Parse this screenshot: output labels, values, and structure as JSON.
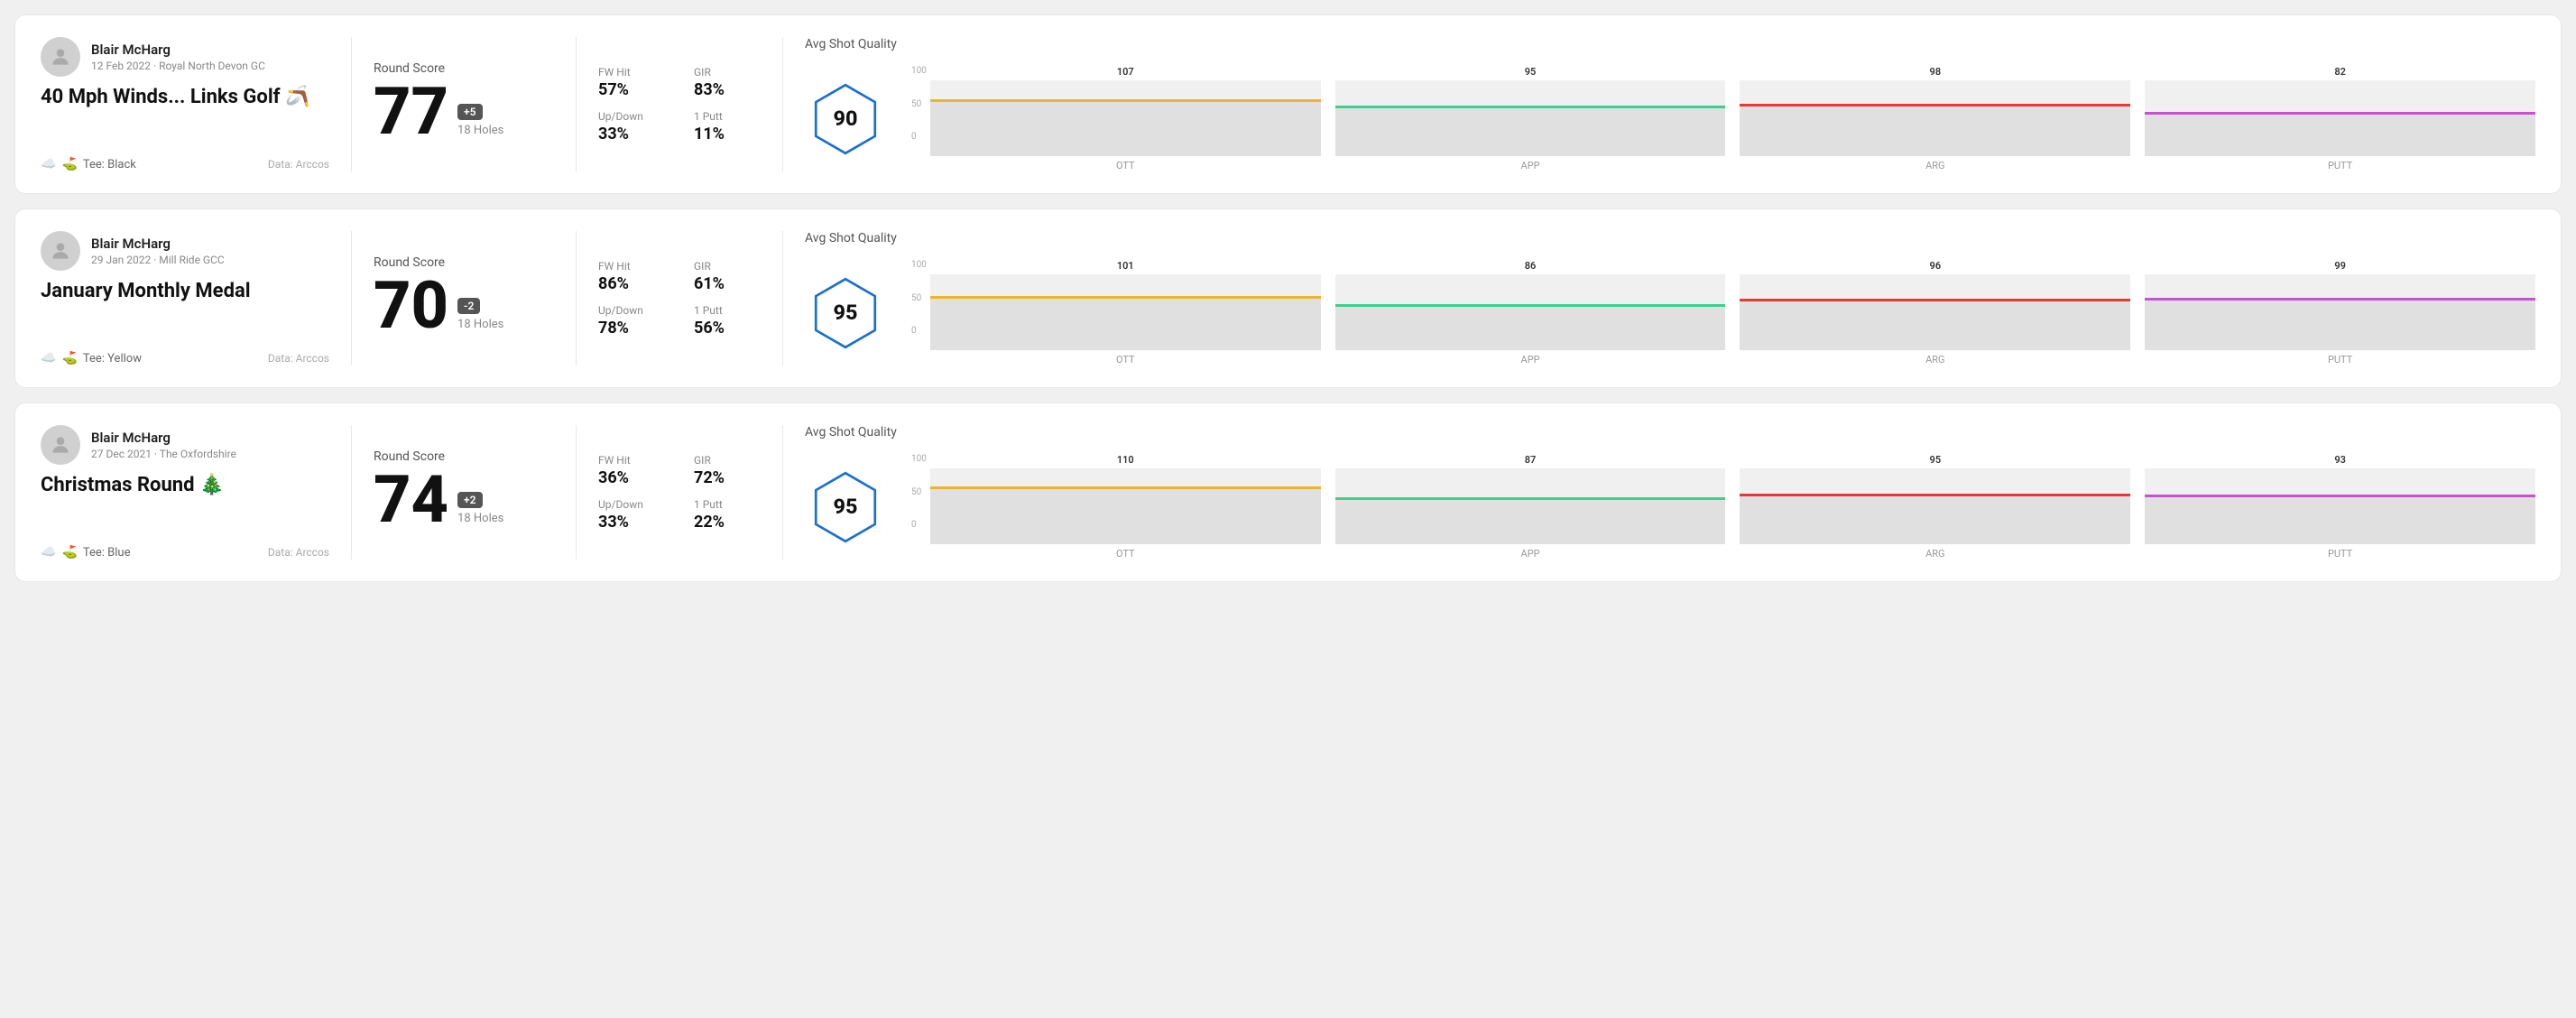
{
  "rounds": [
    {
      "id": "round1",
      "user": {
        "name": "Blair McHarg",
        "date": "12 Feb 2022 · Royal North Devon GC",
        "tee": "Black",
        "data_source": "Data: Arccos"
      },
      "title": "40 Mph Winds... Links Golf 🪃",
      "score": {
        "label": "Round Score",
        "number": "77",
        "badge": "+5",
        "badge_type": "positive",
        "holes": "18 Holes"
      },
      "stats": {
        "fw_hit_label": "FW Hit",
        "fw_hit_value": "57%",
        "gir_label": "GIR",
        "gir_value": "83%",
        "updown_label": "Up/Down",
        "updown_value": "33%",
        "oneputt_label": "1 Putt",
        "oneputt_value": "11%"
      },
      "quality": {
        "title": "Avg Shot Quality",
        "score": "90",
        "bars": [
          {
            "label": "OTT",
            "value": 107,
            "color": "#f0b429",
            "pct": 72
          },
          {
            "label": "APP",
            "value": 95,
            "color": "#3ecf8e",
            "pct": 63
          },
          {
            "label": "ARG",
            "value": 98,
            "color": "#e53935",
            "pct": 65
          },
          {
            "label": "PUTT",
            "value": 82,
            "color": "#c94fd4",
            "pct": 55
          }
        ]
      }
    },
    {
      "id": "round2",
      "user": {
        "name": "Blair McHarg",
        "date": "29 Jan 2022 · Mill Ride GCC",
        "tee": "Yellow",
        "data_source": "Data: Arccos"
      },
      "title": "January Monthly Medal",
      "score": {
        "label": "Round Score",
        "number": "70",
        "badge": "-2",
        "badge_type": "negative",
        "holes": "18 Holes"
      },
      "stats": {
        "fw_hit_label": "FW Hit",
        "fw_hit_value": "86%",
        "gir_label": "GIR",
        "gir_value": "61%",
        "updown_label": "Up/Down",
        "updown_value": "78%",
        "oneputt_label": "1 Putt",
        "oneputt_value": "56%"
      },
      "quality": {
        "title": "Avg Shot Quality",
        "score": "95",
        "bars": [
          {
            "label": "OTT",
            "value": 101,
            "color": "#f0b429",
            "pct": 68
          },
          {
            "label": "APP",
            "value": 86,
            "color": "#3ecf8e",
            "pct": 57
          },
          {
            "label": "ARG",
            "value": 96,
            "color": "#e53935",
            "pct": 64
          },
          {
            "label": "PUTT",
            "value": 99,
            "color": "#c94fd4",
            "pct": 66
          }
        ]
      }
    },
    {
      "id": "round3",
      "user": {
        "name": "Blair McHarg",
        "date": "27 Dec 2021 · The Oxfordshire",
        "tee": "Blue",
        "data_source": "Data: Arccos"
      },
      "title": "Christmas Round 🎄",
      "score": {
        "label": "Round Score",
        "number": "74",
        "badge": "+2",
        "badge_type": "positive",
        "holes": "18 Holes"
      },
      "stats": {
        "fw_hit_label": "FW Hit",
        "fw_hit_value": "36%",
        "gir_label": "GIR",
        "gir_value": "72%",
        "updown_label": "Up/Down",
        "updown_value": "33%",
        "oneputt_label": "1 Putt",
        "oneputt_value": "22%"
      },
      "quality": {
        "title": "Avg Shot Quality",
        "score": "95",
        "bars": [
          {
            "label": "OTT",
            "value": 110,
            "color": "#f0b429",
            "pct": 73
          },
          {
            "label": "APP",
            "value": 87,
            "color": "#3ecf8e",
            "pct": 58
          },
          {
            "label": "ARG",
            "value": 95,
            "color": "#e53935",
            "pct": 63
          },
          {
            "label": "PUTT",
            "value": 93,
            "color": "#c94fd4",
            "pct": 62
          }
        ]
      }
    }
  ],
  "y_axis": {
    "top": "100",
    "mid": "50",
    "bot": "0"
  }
}
